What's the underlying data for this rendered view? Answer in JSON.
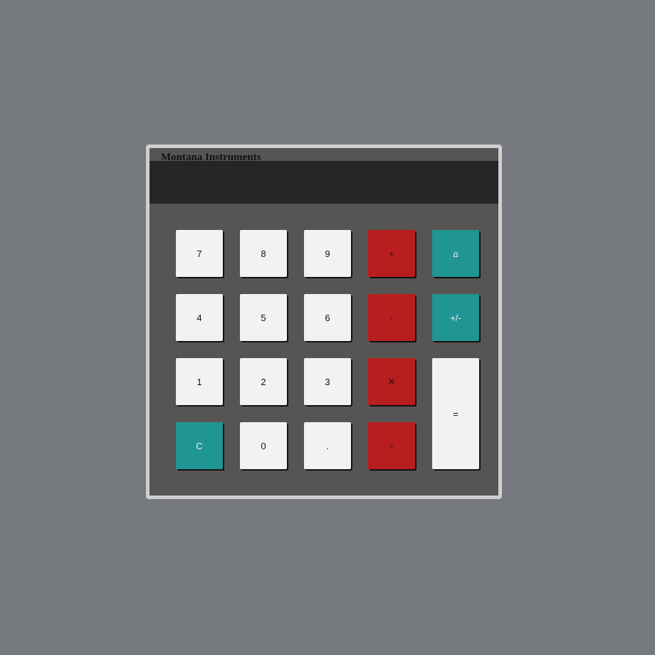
{
  "brand": {
    "name": "Montana Instruments"
  },
  "display": {
    "value": ""
  },
  "keys": {
    "k7": "7",
    "k8": "8",
    "k9": "9",
    "k4": "4",
    "k5": "5",
    "k6": "6",
    "k1": "1",
    "k2": "2",
    "k3": "3",
    "k0": "0",
    "dot": ".",
    "plus": "+",
    "minus": "-",
    "times": "×",
    "divide": "÷",
    "plus_minus": "+/-",
    "clear": "C",
    "equals": "=",
    "special": "ꭥ"
  },
  "colors": {
    "background": "#76797d",
    "body": "#575553",
    "display": "#252525",
    "key_white": "#f2f2f2",
    "key_red": "#b81e1f",
    "key_teal": "#219593"
  }
}
